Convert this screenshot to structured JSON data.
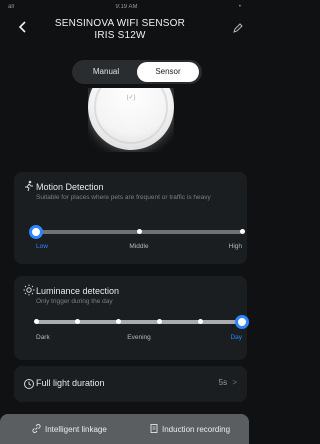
{
  "status_bar": {
    "left": "all",
    "time": "9:19 AM",
    "right": "•"
  },
  "header": {
    "back_icon": "chevron-left-icon",
    "title_line1": "SENSINOVA WIFI SENSOR",
    "title_line2": "IRIS S12W",
    "edit_icon": "edit-icon"
  },
  "mode": {
    "manual": "Manual",
    "sensor": "Sensor",
    "selected": "Sensor"
  },
  "dial": {
    "glyph": "(✓)"
  },
  "motion": {
    "title": "Motion Detection",
    "subtitle": "Suitable for places where pets are frequent or traffic is heavy",
    "levels": [
      "Low",
      "Middle",
      "High"
    ],
    "selected_index": 0
  },
  "luminance": {
    "title": "Luminance detection",
    "subtitle": "Only trigger during the day",
    "labels": [
      "Dark",
      "Evening",
      "Day"
    ],
    "selected_label": "Day"
  },
  "full_light": {
    "label": "Full light duration",
    "value": "5s",
    "chevron": ">"
  },
  "bottom": {
    "intelligent": "Intelligent linkage",
    "induction": "Induction recording"
  },
  "colors": {
    "accent": "#2b86ff",
    "background": "#0f1112",
    "card": "#1b1e20"
  }
}
